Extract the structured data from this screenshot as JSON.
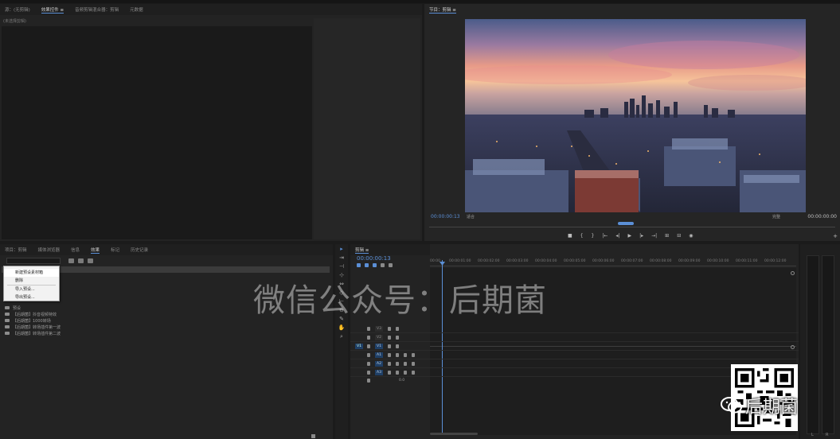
{
  "source_panel": {
    "tabs": [
      {
        "label": "源：(无剪辑)",
        "active": false
      },
      {
        "label": "效果控件 ≡",
        "active": true
      },
      {
        "label": "音频剪辑混合器：剪辑",
        "active": false
      },
      {
        "label": "元数据",
        "active": false
      }
    ],
    "sub_label": "(未选择剪辑)"
  },
  "program_monitor": {
    "tab_label": "节目：剪辑 ≡",
    "timecode": "00:00:00:13",
    "fit": "适合",
    "quality": "完整",
    "duration": "00:00:00:00",
    "transport": [
      "■",
      "{",
      "}",
      "|←",
      "◂|",
      "▶",
      "|▸",
      "→|",
      "⊞",
      "⊟",
      "◉"
    ],
    "add_button": "+"
  },
  "effects_panel": {
    "tabs": [
      {
        "label": "项目：剪辑",
        "active": false
      },
      {
        "label": "媒体浏览器",
        "active": false
      },
      {
        "label": "信息",
        "active": false
      },
      {
        "label": "效果",
        "active": true
      },
      {
        "label": "标记",
        "active": false
      },
      {
        "label": "历史记录",
        "active": false
      }
    ],
    "items": [
      {
        "label": "预设"
      },
      {
        "label": "【后期菌】抖音视频特效"
      },
      {
        "label": "【后期菌】1000转场"
      },
      {
        "label": "【后期菌】转场插件第一波"
      },
      {
        "label": "【后期菌】转场插件第二波"
      }
    ],
    "context_menu": [
      "新建预设素材箱",
      "删除",
      "导入预设...",
      "导出预设..."
    ]
  },
  "timeline": {
    "tab_label": "剪辑 ≡",
    "timecode": "00:00:00:13",
    "ruler": [
      "00:00",
      "00:00:01:00",
      "00:00:02:00",
      "00:00:03:00",
      "00:00:04:00",
      "00:00:05:00",
      "00:00:06:00",
      "00:00:07:00",
      "00:00:08:00",
      "00:00:09:00",
      "00:00:10:00",
      "00:00:11:00",
      "00:00:12:00"
    ],
    "video_tracks": [
      "V3",
      "V2",
      "V1"
    ],
    "audio_tracks": [
      "A1",
      "A2",
      "A3"
    ],
    "source_patch": "V1",
    "master_label": "0.0"
  },
  "audio_meter": {
    "left": "L",
    "right": "R"
  },
  "watermark": {
    "text": "微信公众号：后期菌",
    "brand": "后期菌"
  }
}
